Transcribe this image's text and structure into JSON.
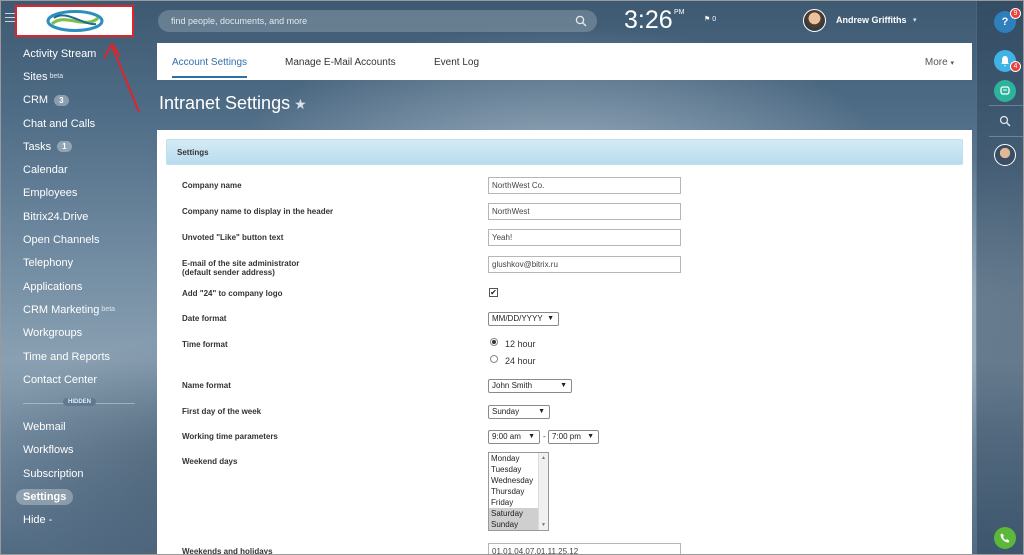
{
  "search": {
    "placeholder": "find people, documents, and more"
  },
  "clock": {
    "time": "3:26",
    "ampm": "PM",
    "flag_count": "0"
  },
  "user": {
    "name": "Andrew Griffiths"
  },
  "sidebar": {
    "items": [
      {
        "label": "Activity Stream"
      },
      {
        "label": "Sites",
        "sup": "beta"
      },
      {
        "label": "CRM",
        "counter": "3"
      },
      {
        "label": "Chat and Calls"
      },
      {
        "label": "Tasks",
        "counter": "1"
      },
      {
        "label": "Calendar"
      },
      {
        "label": "Employees"
      },
      {
        "label": "Bitrix24.Drive"
      },
      {
        "label": "Open Channels"
      },
      {
        "label": "Telephony"
      },
      {
        "label": "Applications"
      },
      {
        "label": "CRM Marketing",
        "sup": "beta"
      },
      {
        "label": "Workgroups"
      },
      {
        "label": "Time and Reports"
      },
      {
        "label": "Contact Center"
      }
    ],
    "hidden_label": "HIDDEN",
    "hidden_items": [
      {
        "label": "Webmail"
      },
      {
        "label": "Workflows"
      },
      {
        "label": "Subscription"
      },
      {
        "label": "Settings"
      },
      {
        "label": "Hide -"
      }
    ]
  },
  "rail": {
    "help_badge": "9",
    "notif_badge": "4"
  },
  "tabs": [
    {
      "label": "Account Settings"
    },
    {
      "label": "Manage E-Mail Accounts"
    },
    {
      "label": "Event Log"
    }
  ],
  "more_label": "More",
  "page_title": "Intranet Settings",
  "settings": {
    "section_title": "Settings",
    "company_name": {
      "label": "Company name",
      "value": "NorthWest Co."
    },
    "company_header": {
      "label": "Company name to display in the header",
      "value": "NorthWest"
    },
    "unvoted_like": {
      "label": "Unvoted \"Like\" button text",
      "value": "Yeah!"
    },
    "admin_email": {
      "label": "E-mail of the site administrator",
      "label2": "(default sender address)",
      "value": "glushkov@bitrix.ru"
    },
    "add24": {
      "label": "Add \"24\" to company logo",
      "checked": "✔"
    },
    "date_format": {
      "label": "Date format",
      "value": "MM/DD/YYYY"
    },
    "time_format": {
      "label": "Time format",
      "opt1": "12 hour",
      "opt2": "24 hour"
    },
    "name_format": {
      "label": "Name format",
      "value": "John Smith"
    },
    "first_day": {
      "label": "First day of the week",
      "value": "Sunday"
    },
    "working_time": {
      "label": "Working time parameters",
      "start": "9:00 am",
      "end": "7:00 pm"
    },
    "weekend_days": {
      "label": "Weekend days",
      "days": [
        "Monday",
        "Tuesday",
        "Wednesday",
        "Thursday",
        "Friday",
        "Saturday",
        "Sunday"
      ]
    },
    "holidays": {
      "label": "Weekends and holidays",
      "value": "01.01,04.07,01.11,25.12"
    }
  }
}
